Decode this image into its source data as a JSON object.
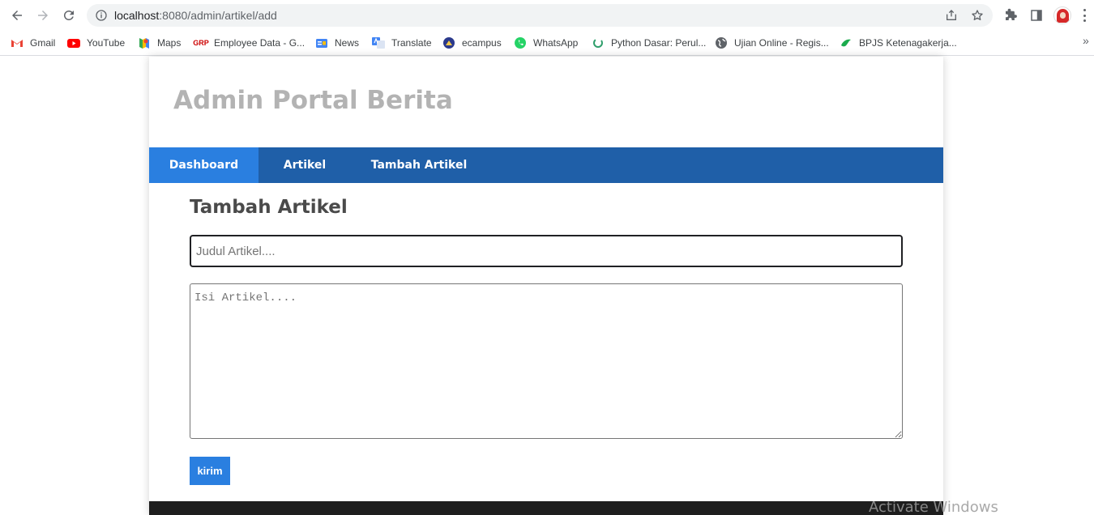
{
  "browser": {
    "url_host": "localhost",
    "url_path": ":8080/admin/artikel/add",
    "bookmarks": [
      {
        "label": "Gmail",
        "icon": "gmail-icon"
      },
      {
        "label": "YouTube",
        "icon": "youtube-icon"
      },
      {
        "label": "Maps",
        "icon": "maps-icon"
      },
      {
        "label": "Employee Data - G...",
        "icon": "grp-icon"
      },
      {
        "label": "News",
        "icon": "news-icon"
      },
      {
        "label": "Translate",
        "icon": "translate-icon"
      },
      {
        "label": "ecampus",
        "icon": "ecampus-icon"
      },
      {
        "label": "WhatsApp",
        "icon": "whatsapp-icon"
      },
      {
        "label": "Python Dasar: Perul...",
        "icon": "python-icon"
      },
      {
        "label": "Ujian Online - Regis...",
        "icon": "globe-icon"
      },
      {
        "label": "BPJS Ketenagakerja...",
        "icon": "bpjs-icon"
      }
    ],
    "more_label": "»",
    "grp_logo_text": "GRP"
  },
  "site": {
    "title": "Admin Portal Berita",
    "nav": [
      {
        "label": "Dashboard",
        "active": true
      },
      {
        "label": "Artikel",
        "active": false
      },
      {
        "label": "Tambah Artikel",
        "active": false
      }
    ]
  },
  "form": {
    "heading": "Tambah Artikel",
    "title_placeholder": "Judul Artikel....",
    "title_value": "",
    "body_placeholder": "Isi Artikel....",
    "body_value": "",
    "submit_label": "kirim"
  },
  "colors": {
    "nav_bg": "#1f5fa8",
    "nav_active": "#2a7fe0",
    "button": "#2a7fe0",
    "title": "#b3b3b3"
  },
  "watermark": "Activate Windows"
}
